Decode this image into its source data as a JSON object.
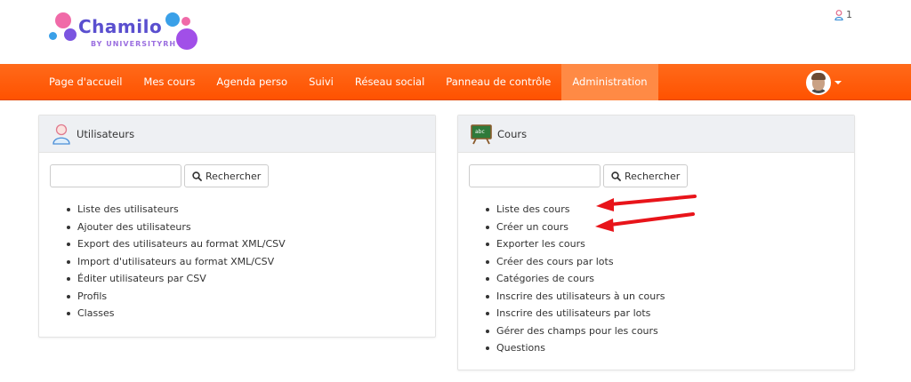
{
  "header": {
    "logo_text": "Chamilo",
    "logo_sub": "BY UNIVERSITYRH",
    "notification_count": "1"
  },
  "nav": {
    "items": [
      {
        "label": "Page d'accueil"
      },
      {
        "label": "Mes cours"
      },
      {
        "label": "Agenda perso"
      },
      {
        "label": "Suivi"
      },
      {
        "label": "Réseau social"
      },
      {
        "label": "Panneau de contrôle"
      },
      {
        "label": "Administration"
      }
    ]
  },
  "users_panel": {
    "title": "Utilisateurs",
    "search_value": "",
    "search_button": "Rechercher",
    "links": [
      "Liste des utilisateurs",
      "Ajouter des utilisateurs",
      "Export des utilisateurs au format XML/CSV",
      "Import d'utilisateurs au format XML/CSV",
      "Éditer utilisateurs par CSV",
      "Profils",
      "Classes"
    ]
  },
  "courses_panel": {
    "title": "Cours",
    "board_text": "abc",
    "search_value": "",
    "search_button": "Rechercher",
    "links": [
      "Liste des cours",
      "Créer un cours",
      "Exporter les cours",
      "Créer des cours par lots",
      "Catégories de cours",
      "Inscrire des utilisateurs à un cours",
      "Inscrire des utilisateurs par lots",
      "Gérer des champs pour les cours",
      "Questions"
    ]
  },
  "colors": {
    "navbar": "#ff5a0a",
    "nav_active": "#ff8a45",
    "arrow": "#e8141a",
    "logo": "#5a4fcf"
  }
}
